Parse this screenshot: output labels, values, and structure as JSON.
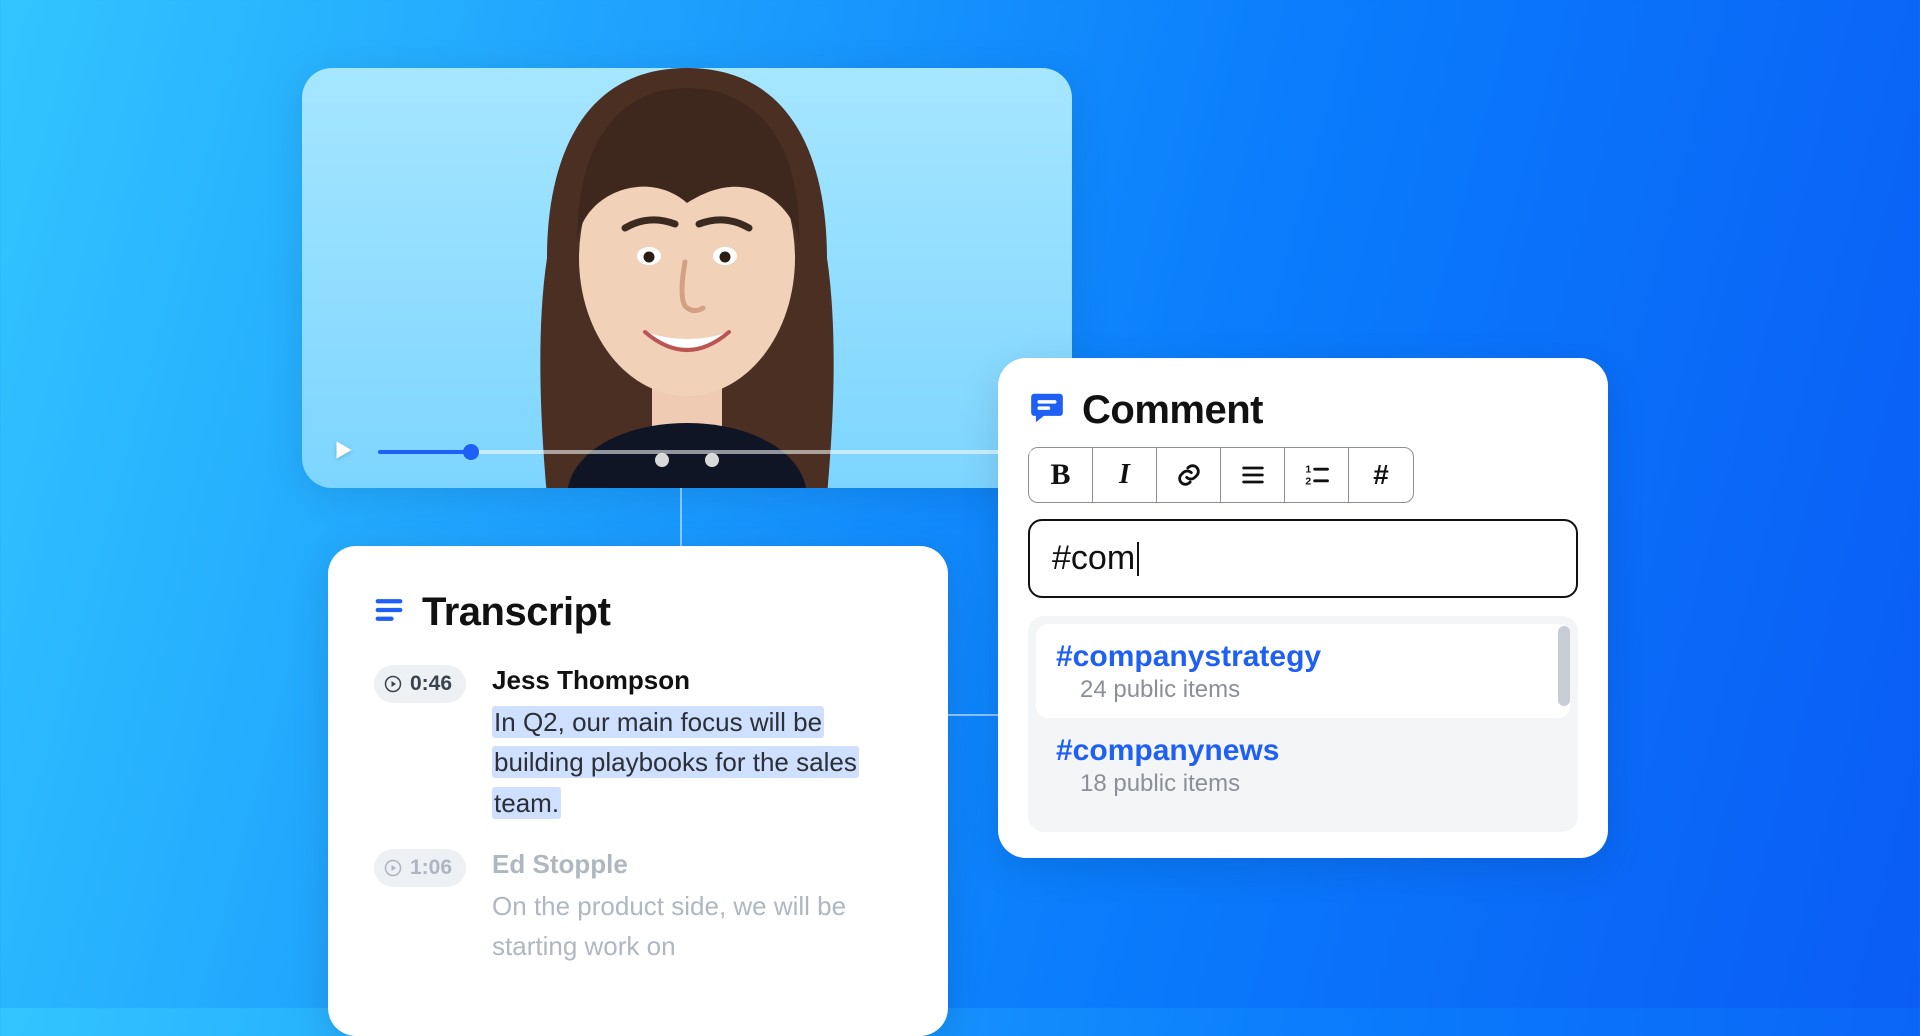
{
  "video": {
    "progress_pct": 14
  },
  "transcript": {
    "title": "Transcript",
    "entries": [
      {
        "timestamp": "0:46",
        "speaker": "Jess Thompson",
        "text": "In Q2, our main focus will be building playbooks for the sales team.",
        "selected": true
      },
      {
        "timestamp": "1:06",
        "speaker": "Ed Stopple",
        "text": "On the product side, we will be starting work on",
        "selected": false
      }
    ]
  },
  "comment": {
    "title": "Comment",
    "input_value": "#com",
    "toolbar": {
      "bold": "B",
      "italic": "I",
      "hash": "#"
    },
    "suggestions": [
      {
        "tag": "#companystrategy",
        "meta": "24 public items",
        "active": true
      },
      {
        "tag": "#companynews",
        "meta": "18 public items",
        "active": false
      }
    ]
  }
}
